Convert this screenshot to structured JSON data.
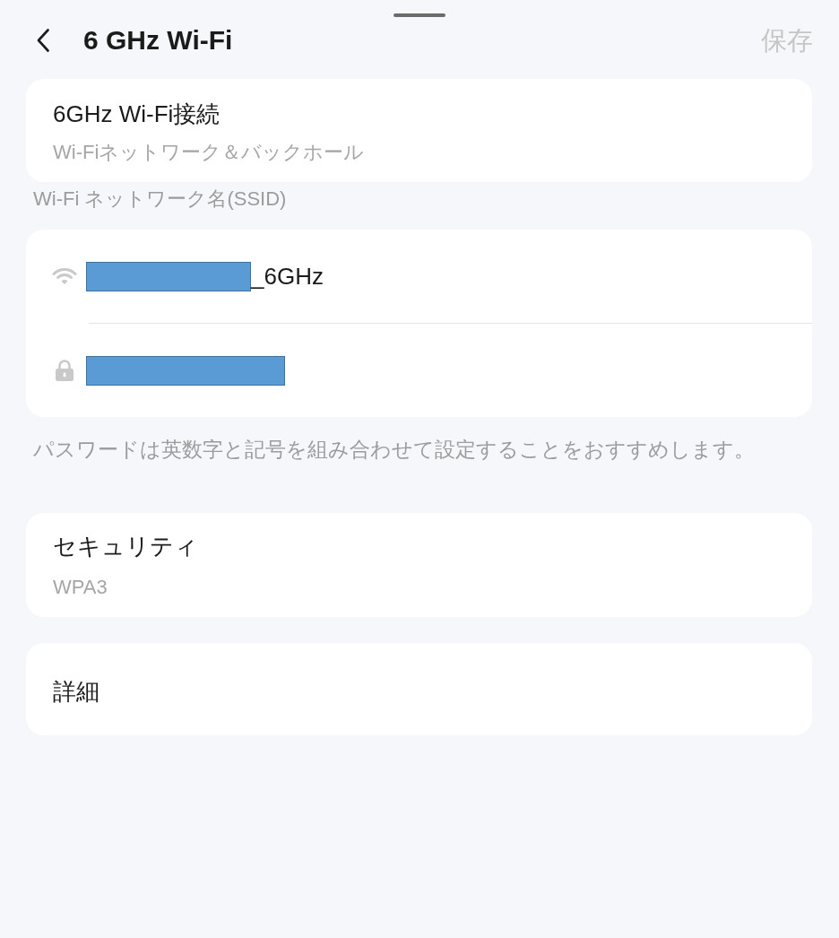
{
  "header": {
    "title": "6 GHz Wi-Fi",
    "action": {
      "label": "保存",
      "disabled": true
    }
  },
  "connection": {
    "title": "6GHz Wi-Fi接続",
    "subtitle": "Wi-Fiネットワーク＆バックホール"
  },
  "ssid_section": {
    "label": "Wi-Fi ネットワーク名(SSID)",
    "fields": [
      {
        "kind": "ssid",
        "redacted": true,
        "value": "_6GHz"
      },
      {
        "kind": "password",
        "redacted": true
      }
    ]
  },
  "hint": "パスワードは英数字と記号を組み合わせて設定することをおすすめします。",
  "security": {
    "title": "セキュリティ",
    "value": "WPA3"
  },
  "details": {
    "title": "詳細"
  }
}
